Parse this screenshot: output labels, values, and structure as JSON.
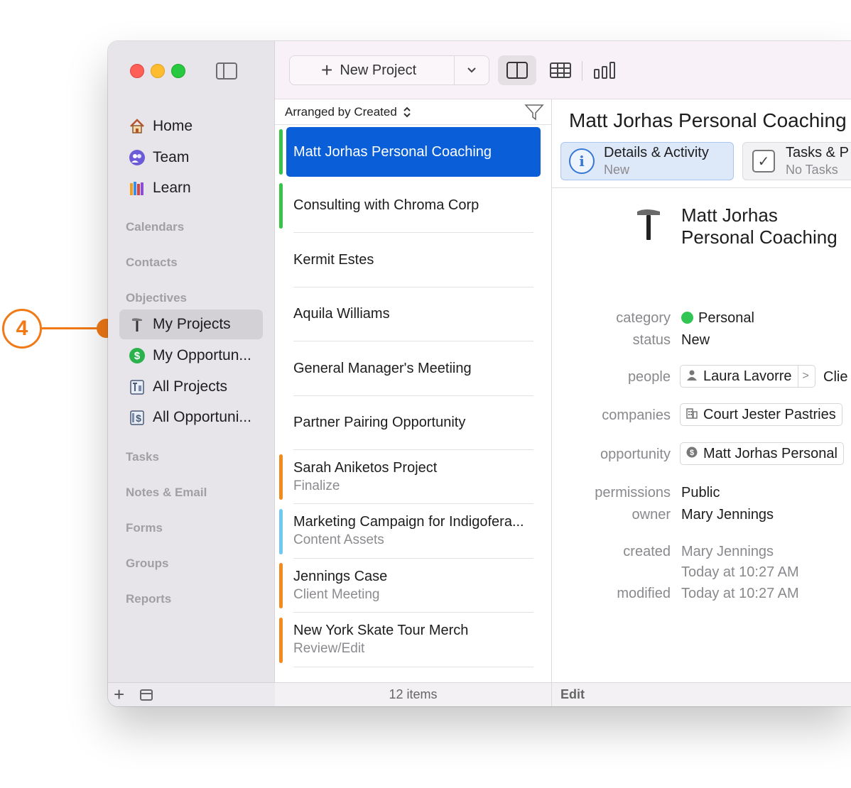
{
  "callout": {
    "number": "4"
  },
  "sidebar": {
    "nav": [
      {
        "label": "Home",
        "icon": "house-icon"
      },
      {
        "label": "Team",
        "icon": "team-icon"
      },
      {
        "label": "Learn",
        "icon": "books-icon"
      }
    ],
    "sections": {
      "calendars": "Calendars",
      "contacts": "Contacts",
      "objectives": "Objectives",
      "tasks": "Tasks",
      "notes": "Notes & Email",
      "forms": "Forms",
      "groups": "Groups",
      "reports": "Reports"
    },
    "objectives": [
      {
        "label": "My Projects",
        "icon": "hammer-icon",
        "active": true
      },
      {
        "label": "My Opportun...",
        "icon": "dollar-icon"
      },
      {
        "label": "All Projects",
        "icon": "projects-icon"
      },
      {
        "label": "All Opportuni...",
        "icon": "opportunities-icon"
      }
    ]
  },
  "toolbar": {
    "new_project_label": "New Project"
  },
  "list": {
    "arranged_by": "Arranged by Created",
    "items": [
      {
        "title": "Matt Jorhas Personal Coaching",
        "sub": "",
        "bar": "#37c24a"
      },
      {
        "title": "Consulting with Chroma Corp",
        "sub": "",
        "bar": "#37c24a"
      },
      {
        "title": "Kermit Estes",
        "sub": "",
        "bar": ""
      },
      {
        "title": "Aquila Williams",
        "sub": "",
        "bar": ""
      },
      {
        "title": "General Manager's Meetiing",
        "sub": "",
        "bar": ""
      },
      {
        "title": "Partner Pairing Opportunity",
        "sub": "",
        "bar": ""
      },
      {
        "title": "Sarah Aniketos Project",
        "sub": "Finalize",
        "bar": "#f28a1e"
      },
      {
        "title": "Marketing Campaign for Indigofera...",
        "sub": "Content Assets",
        "bar": "#6fc9f2"
      },
      {
        "title": "Jennings Case",
        "sub": "Client Meeting",
        "bar": "#f28a1e"
      },
      {
        "title": "New York Skate Tour Merch",
        "sub": "Review/Edit",
        "bar": "#f28a1e"
      }
    ],
    "count": "12 items"
  },
  "detail": {
    "title": "Matt Jorhas Personal Coaching",
    "tabs": {
      "details_label": "Details & Activity",
      "details_sub": "New",
      "tasks_label": "Tasks & P",
      "tasks_sub": "No Tasks"
    },
    "name_line1": "Matt Jorhas",
    "name_line2": "Personal Coaching",
    "fields": {
      "category_label": "category",
      "category_value": "Personal",
      "status_label": "status",
      "status_value": "New",
      "people_label": "people",
      "people_value": "Laura Lavorre",
      "people_extra": "Clie",
      "companies_label": "companies",
      "companies_value": "Court Jester Pastries",
      "opportunity_label": "opportunity",
      "opportunity_value": "Matt Jorhas Personal",
      "permissions_label": "permissions",
      "permissions_value": "Public",
      "owner_label": "owner",
      "owner_value": "Mary Jennings",
      "created_label": "created",
      "created_by": "Mary Jennings",
      "created_at": "Today at 10:27 AM",
      "modified_label": "modified",
      "modified_at": "Today at 10:27 AM"
    },
    "edit_label": "Edit"
  }
}
